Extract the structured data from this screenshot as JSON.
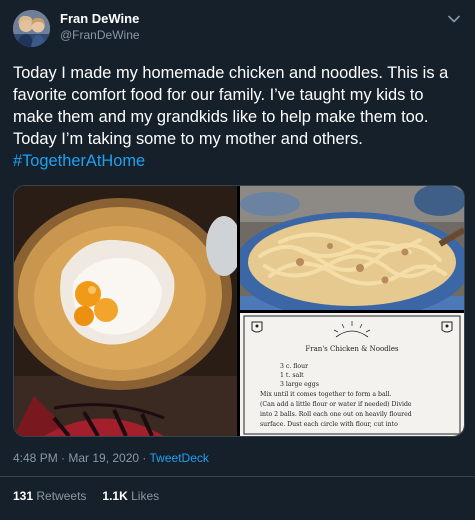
{
  "author": {
    "name": "Fran DeWine",
    "handle": "@FranDeWine",
    "avatar_icon": "avatar-photo"
  },
  "tweet": {
    "text": "Today I made my homemade chicken and noodles. This is a favorite comfort food for our family. I’ve taught my kids to make them and my grandkids like to help make them too. Today I’m taking some to my mother and others. ",
    "hashtag": "#TogetherAtHome",
    "timestamp": "4:48 PM · Mar 19, 2020 · ",
    "source": "TweetDeck"
  },
  "media": {
    "left_image": "flour-and-eggs-in-bowl",
    "top_right_image": "noodles-in-pot",
    "recipe": {
      "title": "Fran's Chicken & Noodles",
      "lines": [
        "3 c. flour",
        "1 t. salt",
        "3 large eggs",
        "Mix until it comes together to form a ball.",
        "(Can add a little flour or water if needed) Divide",
        "into 2 balls. Roll each one out on heavily floured",
        "surface. Dust each circle with flour, cut into"
      ]
    }
  },
  "stats": {
    "retweets_count": "131",
    "retweets_label": "Retweets",
    "likes_count": "1.1K",
    "likes_label": "Likes"
  },
  "colors": {
    "background": "#15202b",
    "accent": "#1da1f2",
    "secondary_text": "#8899a6",
    "border": "#38444d"
  }
}
